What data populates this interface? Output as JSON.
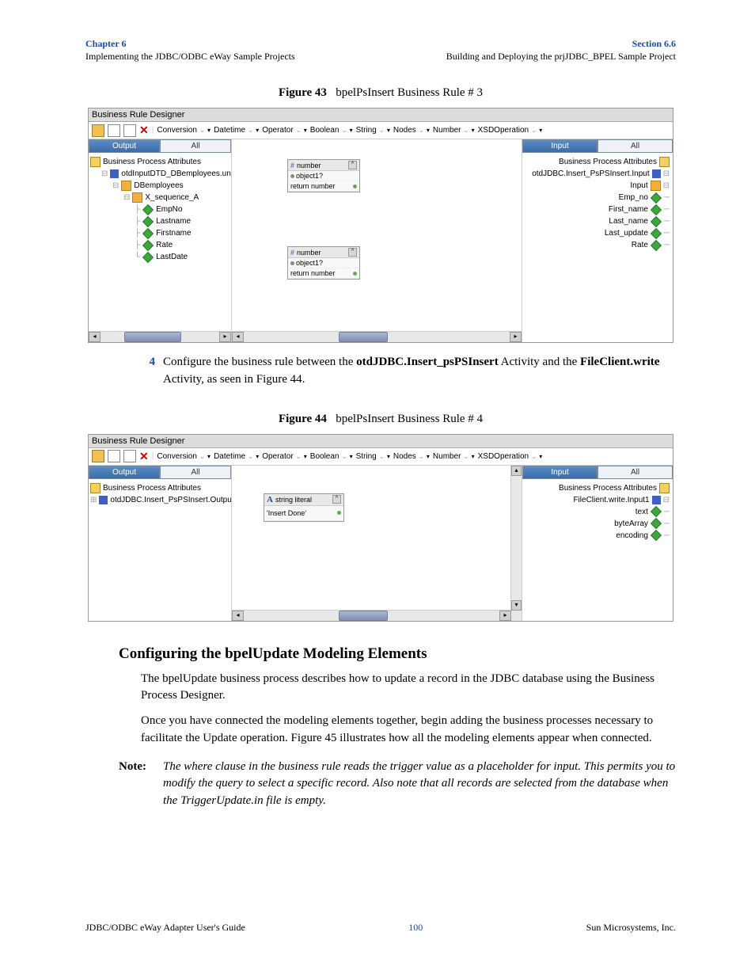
{
  "header": {
    "chapter": "Chapter 6",
    "chapter_sub": "Implementing the JDBC/ODBC eWay Sample Projects",
    "section": "Section 6.6",
    "section_sub": "Building and Deploying the prjJDBC_BPEL Sample Project"
  },
  "figure43": {
    "label": "Figure 43",
    "title": "bpelPsInsert Business Rule # 3",
    "designer_title": "Business Rule Designer",
    "toolbar": {
      "menus": [
        "Conversion",
        "Datetime",
        "Operator",
        "Boolean",
        "String",
        "Nodes",
        "Number",
        "XSDOperation"
      ]
    },
    "left_tabs": {
      "output": "Output",
      "all": "All"
    },
    "right_tabs": {
      "input": "Input",
      "all": "All"
    },
    "left_tree": {
      "root": "Business Process Attributes",
      "n1": "otdInputDTD_DBemployees.unmar",
      "n2": "DBemployees",
      "n3": "X_sequence_A",
      "leaves": [
        "EmpNo",
        "Lastname",
        "Firstname",
        "Rate",
        "LastDate"
      ]
    },
    "right_tree": {
      "root": "Business Process Attributes",
      "n1": "otdJDBC.Insert_PsPSInsert.Input",
      "n2": "Input",
      "leaves": [
        "Emp_no",
        "First_name",
        "Last_name",
        "Last_update",
        "Rate"
      ]
    },
    "func": {
      "number": "number",
      "obj": "object1?",
      "ret": "return number"
    }
  },
  "step4": {
    "num": "4",
    "text_pre": "Configure the business rule between the ",
    "bold1": "otdJDBC.Insert_psPSInsert",
    "text_mid": " Activity and the ",
    "bold2": "FileClient.write",
    "text_post": " Activity, as seen in Figure 44."
  },
  "figure44": {
    "label": "Figure 44",
    "title": "bpelPsInsert Business Rule # 4",
    "designer_title": "Business Rule Designer",
    "left_tree": {
      "root": "Business Process Attributes",
      "n1": "otdJDBC.Insert_PsPSInsert.Output"
    },
    "right_tree": {
      "root": "Business Process Attributes",
      "n1": "FileClient.write.Input1",
      "leaves": [
        "text",
        "byteArray",
        "encoding"
      ]
    },
    "func": {
      "literal": "string literal",
      "value": "'Insert Done'"
    }
  },
  "section_heading": "Configuring the bpelUpdate Modeling Elements",
  "para1": "The bpelUpdate business process describes how to update a record in the JDBC database using the Business Process Designer.",
  "para2": "Once you have connected the modeling elements together, begin adding the business processes necessary to facilitate the Update operation. Figure 45 illustrates how all the modeling elements appear when connected.",
  "note": {
    "label": "Note:",
    "text": "The where clause in the business rule reads the trigger value as a placeholder for input. This permits you to modify the query to select a specific record. Also note that all records are selected from the database when the TriggerUpdate.in file is empty."
  },
  "footer": {
    "left": "JDBC/ODBC eWay Adapter User's Guide",
    "center": "100",
    "right": "Sun Microsystems, Inc."
  }
}
